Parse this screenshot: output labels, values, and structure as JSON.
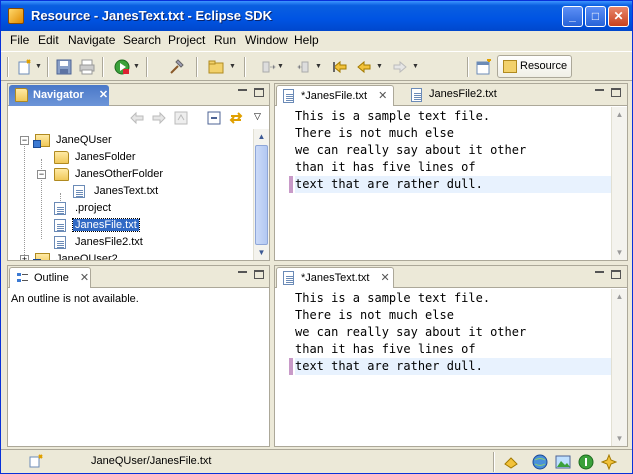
{
  "window": {
    "title": "Resource - JanesText.txt - Eclipse SDK",
    "min_label": "_",
    "max_label": "□",
    "close_label": "✕"
  },
  "menu": [
    "File",
    "Edit",
    "Navigate",
    "Search",
    "Project",
    "Run",
    "Window",
    "Help"
  ],
  "toolbar": {
    "perspective_label": "Resource",
    "icons": [
      "new-wizard-icon",
      "save-icon",
      "print-icon",
      "run-icon",
      "hammer-icon",
      "open-type-icon",
      "next-annotation-icon",
      "prev-annotation-icon",
      "last-edit-icon",
      "back-icon",
      "forward-icon",
      "open-perspective-icon"
    ]
  },
  "navigator": {
    "title": "Navigator",
    "tree": [
      {
        "label": "JaneQUser",
        "type": "project",
        "expanded": true
      },
      {
        "label": "JanesFolder",
        "type": "folder"
      },
      {
        "label": "JanesOtherFolder",
        "type": "folder",
        "expanded": true
      },
      {
        "label": "JanesText.txt",
        "type": "file"
      },
      {
        "label": ".project",
        "type": "file"
      },
      {
        "label": "JanesFile.txt",
        "type": "file",
        "selected": true
      },
      {
        "label": "JanesFile2.txt",
        "type": "file"
      },
      {
        "label": "JaneQUser2",
        "type": "project",
        "expanded": false
      }
    ]
  },
  "outline": {
    "title": "Outline",
    "message": "An outline is not available."
  },
  "editor_top": {
    "tabs": [
      {
        "label": "*JanesFile.txt",
        "active": true
      },
      {
        "label": "JanesFile2.txt",
        "active": false
      }
    ],
    "lines": [
      "This is a sample text file.",
      "There is not much else",
      "we can really say about it other",
      "than it has five lines of",
      "text that are rather dull."
    ]
  },
  "editor_bottom": {
    "tabs": [
      {
        "label": "*JanesText.txt",
        "active": true
      }
    ],
    "lines": [
      "This is a sample text file.",
      "There is not much else",
      "we can really say about it other",
      "than it has five lines of",
      "text that are rather dull."
    ]
  },
  "status": {
    "text": "JaneQUser/JanesFile.txt"
  },
  "colors": {
    "title_bar": "#0054e3",
    "chrome": "#ece9d8",
    "selection": "#316ac5",
    "current_line": "#e8f2fe"
  }
}
